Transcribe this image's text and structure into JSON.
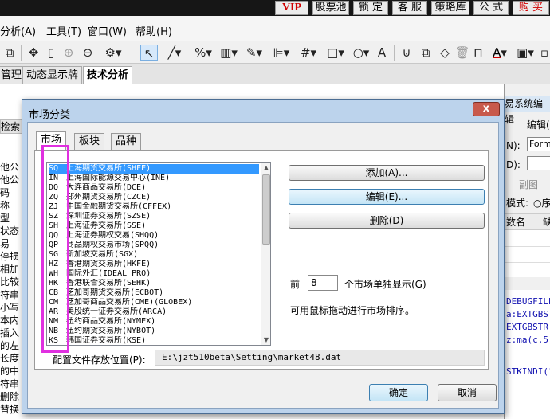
{
  "topbar": {
    "buttons": [
      {
        "label": "VIP",
        "kind": "vip"
      },
      {
        "label": "股票池",
        "kind": "normal"
      },
      {
        "label": "锁 定",
        "kind": "normal"
      },
      {
        "label": "客 服",
        "kind": "normal"
      },
      {
        "label": "策略库",
        "kind": "normal"
      },
      {
        "label": "公 式",
        "kind": "normal"
      },
      {
        "label": "购 买",
        "kind": "buy"
      }
    ]
  },
  "menubar": {
    "items": [
      "分析(A)",
      "工具(T)",
      "窗口(W)",
      "帮助(H)"
    ]
  },
  "tabbar": {
    "tabs": [
      {
        "label": "管理",
        "active": false
      },
      {
        "label": "动态显示牌",
        "active": false
      },
      {
        "label": "技术分析",
        "active": true
      }
    ]
  },
  "left_panel": {
    "search_tab": "检索",
    "labels": [
      "他公",
      "他公",
      "码",
      "称",
      "型",
      "状态",
      "易",
      "停损",
      "相加",
      "比较",
      "符串",
      "小写",
      "本内",
      "插入",
      "的左",
      "长度",
      "的中",
      "符串",
      "删除",
      "替换"
    ]
  },
  "right_panel": {
    "title": "易系统编辑",
    "edit_label": "编辑(",
    "field_n": "N):",
    "field_n_value": "Formul",
    "field_d": "D):",
    "sub_label": "副图",
    "mode_label": "模式:",
    "mode_option": "序",
    "grid_header": "数名",
    "grid_header2": "缺",
    "code_lines": [
      "DEBUGFILE",
      "a:EXTGBS",
      "EXTGBSTR",
      "z:ma(c,5)",
      "STKINDI(\""
    ]
  },
  "dialog": {
    "title": "市场分类",
    "close_label": "x",
    "tabs": [
      {
        "label": "市场",
        "active": true
      },
      {
        "label": "板块",
        "active": false
      },
      {
        "label": "品种",
        "active": false
      }
    ],
    "markets": [
      {
        "code": "SQ",
        "name": "上海期货交易所(SHFE)",
        "selected": true
      },
      {
        "code": "IN",
        "name": "上海国际能源交易中心(INE)",
        "selected": false
      },
      {
        "code": "DQ",
        "name": "大连商品交易所(DCE)",
        "selected": false
      },
      {
        "code": "ZQ",
        "name": "郑州期货交易所(CZCE)",
        "selected": false
      },
      {
        "code": "ZJ",
        "name": "中国金融期货交易所(CFFEX)",
        "selected": false
      },
      {
        "code": "SZ",
        "name": "深圳证券交易所(SZSE)",
        "selected": false
      },
      {
        "code": "SH",
        "name": "上海证券交易所(SSE)",
        "selected": false
      },
      {
        "code": "QQ",
        "name": "上海证券期权交易(SHQQ)",
        "selected": false
      },
      {
        "code": "QP",
        "name": "商品期权交易市场(SPQQ)",
        "selected": false
      },
      {
        "code": "SG",
        "name": "新加坡交易所(SGX)",
        "selected": false
      },
      {
        "code": "HZ",
        "name": "香港期货交易所(HKFE)",
        "selected": false
      },
      {
        "code": "WH",
        "name": "国际外汇(IDEAL PRO)",
        "selected": false
      },
      {
        "code": "HK",
        "name": "香港联合交易所(SEHK)",
        "selected": false
      },
      {
        "code": "CB",
        "name": "芝加哥期货交易所(ECBOT)",
        "selected": false
      },
      {
        "code": "CM",
        "name": "芝加哥商品交易所(CME)(GLOBEX)",
        "selected": false
      },
      {
        "code": "AR",
        "name": "美股统一证券交易所(ARCA)",
        "selected": false
      },
      {
        "code": "NM",
        "name": "纽约商品交易所(NYMEX)",
        "selected": false
      },
      {
        "code": "NB",
        "name": "纽约期货交易所(NYBOT)",
        "selected": false
      },
      {
        "code": "KS",
        "name": "韩国证券交易所(KSE)",
        "selected": false
      }
    ],
    "buttons": {
      "add": "添加(A)...",
      "edit": "编辑(E)...",
      "delete": "删除(D)"
    },
    "count_prefix": "前",
    "count_value": "8",
    "count_suffix": "个市场单独显示(G)",
    "drag_hint": "可用鼠标拖动进行市场排序。",
    "path_label": "配置文件存放位置(P):",
    "path_value": "E:\\jzt510beta\\Setting\\market48.dat",
    "ok": "确定",
    "cancel": "取消"
  },
  "colors": {
    "highlight_box": "#e030e0",
    "selection": "#3399ff",
    "dialog_frame": "#bcd3ec",
    "close_button": "#c85a4c",
    "topbar_red": "#d00000"
  }
}
